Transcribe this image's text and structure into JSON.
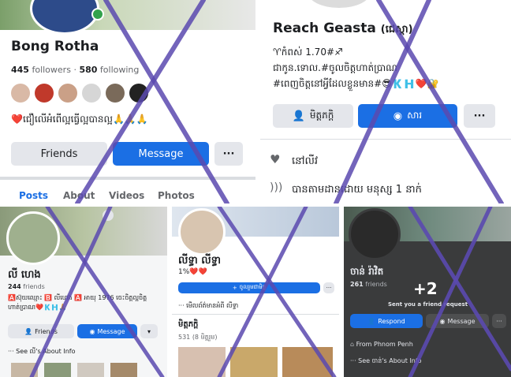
{
  "p1": {
    "name": "Bong Rotha",
    "followers": "445",
    "followers_label": "followers",
    "following": "580",
    "following_label": "following",
    "bio": "❤️ជឿលើអំពើល្អធ្វើល្អបានល្អ🙏🙏🙏",
    "friends_btn": "Friends",
    "message_btn": "Message",
    "more_btn": "···",
    "tabs": [
      "Posts",
      "About",
      "Videos",
      "Photos"
    ]
  },
  "p2": {
    "name": "Reach Geasta",
    "name_suffix": "(ជេស្តា)",
    "bio1": "♈កំពស់ 1.70#♐",
    "bio2": "ជាកូន.ទោល.#ចូលចិត្តហាត់ប្រាណ",
    "bio3": "#ពេញចិត្តនៅអ្វីដែលខ្លួនមាន#😎🇰🇭❤️🔐",
    "friends_btn": "មិត្តភក្តិ",
    "message_btn": "សារ",
    "more_btn": "···",
    "status": "នៅលីវ",
    "followed_by": "បានតាមដានដោយ មនុស្ស 1 នាក់"
  },
  "p3": {
    "name": "លី ហេង",
    "friends": "244",
    "friends_label": "friends",
    "bio": "🅰️ស៊ុយឈ្មោះ 🅱️ លីហេង 🅰️ អាយុ 1976 ចេះចិត្តល្អចិត្តហាត់ប្រាណ❤️🇰🇭🙏",
    "friends_btn": "Friends",
    "message_btn": "Message",
    "about": "See លី's About Info"
  },
  "p4": {
    "name": "លីទ្ធា លីទ្ធា",
    "sub": "1%❤️❤️",
    "add_btn": "ចូលរួមជាមិត្ត",
    "about": "មើលព័ត៌មានអំពី លីទ្ធា",
    "friends_title": "មិត្តភក្តិ",
    "friends_count": "531 (8 មិត្តរួម)"
  },
  "p5": {
    "name": "ចាន់ រ៉ាវិត",
    "friends": "261",
    "friends_label": "friends",
    "plus": "+2",
    "request": "Sent you a friend request",
    "respond_btn": "Respond",
    "message_btn": "Message",
    "from": "From Phnom Penh",
    "about": "See ចាន់'s About Info"
  },
  "colors": {
    "accent": "#1b6fe4",
    "cross": "#5b4ab0"
  }
}
